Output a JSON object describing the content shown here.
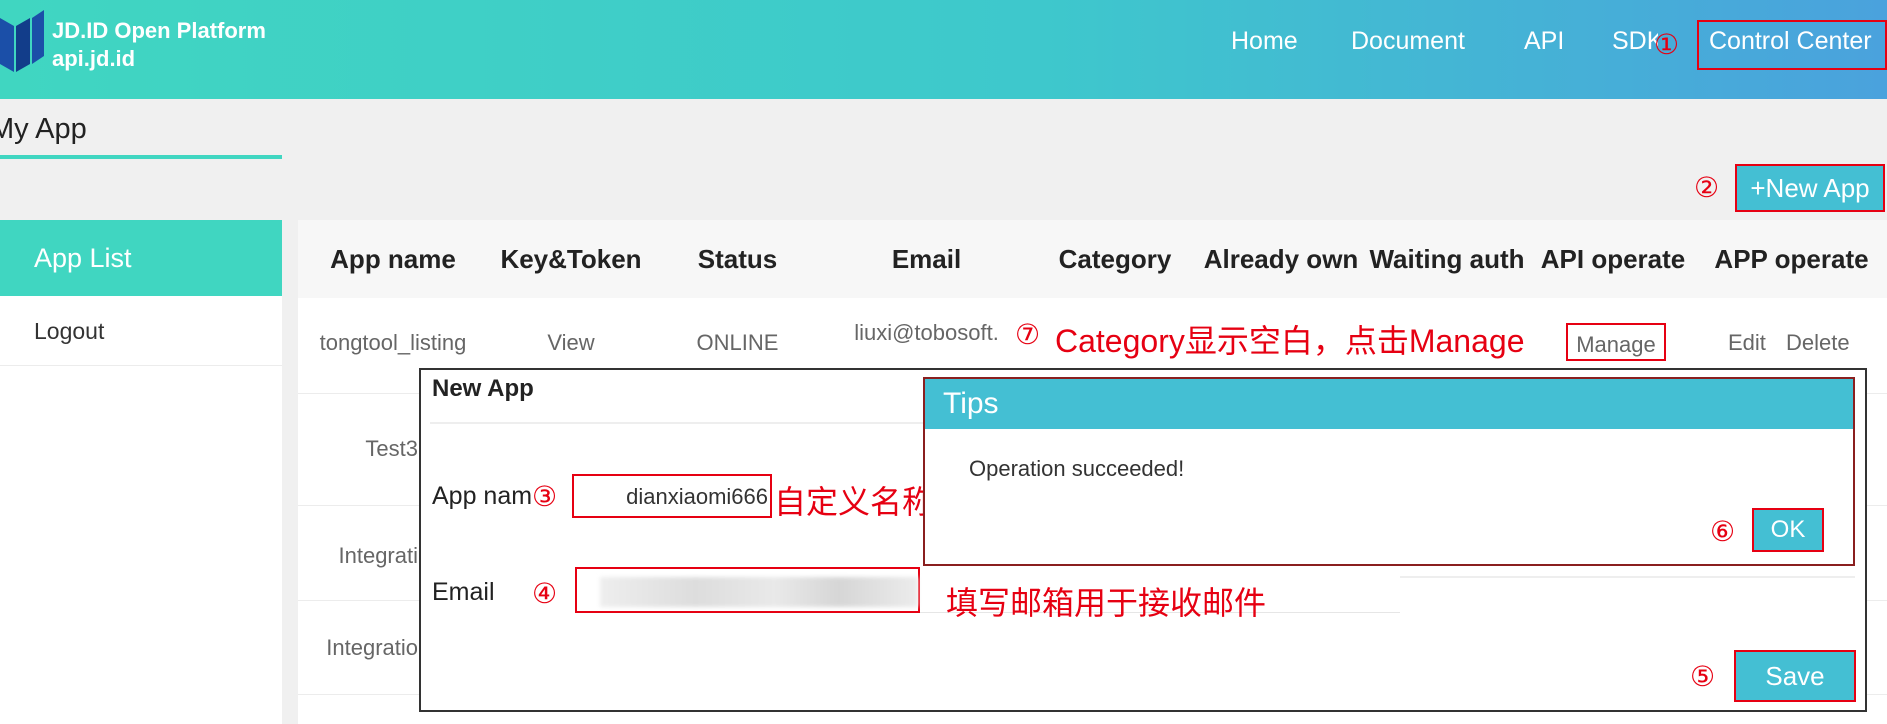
{
  "header": {
    "logo_line1": "JD.ID Open Platform",
    "logo_line2": "api.jd.id",
    "nav": [
      "Home",
      "Document",
      "API",
      "SDK",
      "Control Center"
    ]
  },
  "page_title": "My App",
  "new_app_button": "+New App",
  "sidebar": {
    "items": [
      "App List",
      "Logout"
    ]
  },
  "table": {
    "columns": [
      "App name",
      "Key&Token",
      "Status",
      "Email",
      "Category",
      "Already own",
      "Waiting auth",
      "API operate",
      "APP operate"
    ],
    "row1": {
      "app_name": "tongtool_listing",
      "key_token": "View",
      "status": "ONLINE",
      "email": "liuxi@tobosoft.",
      "api_operate": "Manage",
      "edit": "Edit",
      "delete": "Delete"
    },
    "partial_rows": [
      "Test3",
      "Integrati",
      "Integratio"
    ]
  },
  "dialog": {
    "title": "New App",
    "app_name_label": "App nam",
    "app_name_value": "dianxiaomi666",
    "email_label": "Email",
    "save_label": "Save"
  },
  "tips": {
    "title": "Tips",
    "message": "Operation succeeded!",
    "ok_label": "OK"
  },
  "annotations": {
    "c1": "①",
    "c2": "②",
    "c3": "③",
    "c4": "④",
    "c5": "⑤",
    "c6": "⑥",
    "c7": "⑦",
    "note_category": "Category显示空白，点击Manage",
    "note_name": "自定义名称",
    "note_email": "填写邮箱用于接收邮件"
  },
  "colors": {
    "accent": "#40d6c1",
    "button": "#44bfd3",
    "annotation": "#e60012"
  }
}
